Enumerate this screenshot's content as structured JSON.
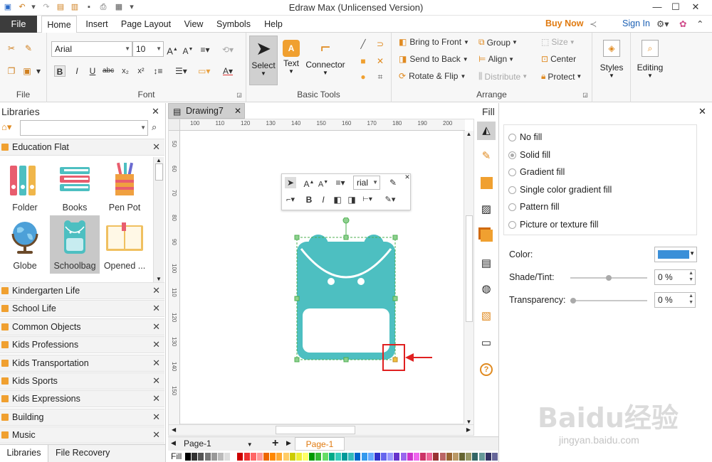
{
  "app": {
    "title": "Edraw Max (Unlicensed Version)"
  },
  "quick_access": {
    "icons": [
      "save-icon",
      "undo-icon",
      "redo-icon",
      "new-icon",
      "open-icon",
      "print-icon",
      "export-icon",
      "customize-icon"
    ]
  },
  "window": {
    "minimize": "—",
    "maximize": "☐",
    "close": "✕",
    "help": "?"
  },
  "ribbon_tabs": {
    "file": "File",
    "tabs": [
      "Home",
      "Insert",
      "Page Layout",
      "View",
      "Symbols",
      "Help"
    ],
    "active": "Home"
  },
  "account": {
    "buy_now": "Buy Now",
    "sign_in": "Sign In"
  },
  "ribbon": {
    "file_group_label": "File",
    "font_group_label": "Font",
    "font_name": "Arial",
    "font_size": "10",
    "basic_tools_label": "Basic Tools",
    "select": "Select",
    "text": "Text",
    "connector": "Connector",
    "arrange_label": "Arrange",
    "bring_to_front": "Bring to Front",
    "send_to_back": "Send to Back",
    "rotate_flip": "Rotate & Flip",
    "group": "Group",
    "align": "Align",
    "distribute": "Distribute",
    "size": "Size",
    "center": "Center",
    "protect": "Protect",
    "styles": "Styles",
    "editing": "Editing"
  },
  "libraries": {
    "title": "Libraries",
    "search_value": "",
    "active_category": "Education Flat",
    "shapes": [
      {
        "label": "Folder"
      },
      {
        "label": "Books"
      },
      {
        "label": "Pen Pot"
      },
      {
        "label": "Globe"
      },
      {
        "label": "Schoolbag"
      },
      {
        "label": "Opened ..."
      }
    ],
    "selected_shape": "Schoolbag",
    "categories": [
      "Kindergarten Life",
      "School Life",
      "Common Objects",
      "Kids Professions",
      "Kids Transportation",
      "Kids Sports",
      "Kids Expressions",
      "Building",
      "Music"
    ],
    "bottom_tabs": [
      "Libraries",
      "File Recovery"
    ]
  },
  "document": {
    "tab": "Drawing7",
    "ruler_h": [
      "100",
      "110",
      "120",
      "130",
      "140",
      "150",
      "160",
      "170",
      "180",
      "190",
      "200"
    ],
    "ruler_v": [
      "50",
      "60",
      "70",
      "80",
      "90",
      "100",
      "110",
      "120",
      "130",
      "140",
      "150"
    ],
    "float_font": "rial",
    "page_tab": "Page-1",
    "page_tab_active": "Page-1",
    "fill_label": "Fill",
    "shape_color": "#4dbfc1"
  },
  "fill_panel": {
    "title": "Fill",
    "options": [
      "No fill",
      "Solid fill",
      "Gradient fill",
      "Single color gradient fill",
      "Pattern fill",
      "Picture or texture fill"
    ],
    "selected": "Solid fill",
    "color_label": "Color:",
    "color_value": "#3a8fd8",
    "shade_label": "Shade/Tint:",
    "shade_value": "0 %",
    "shade_level": 0.5,
    "transparency_label": "Transparency:",
    "transparency_value": "0 %",
    "transparency_level": 0
  },
  "watermark": {
    "text": "Baidu经验",
    "sub": "jingyan.baidu.com"
  }
}
